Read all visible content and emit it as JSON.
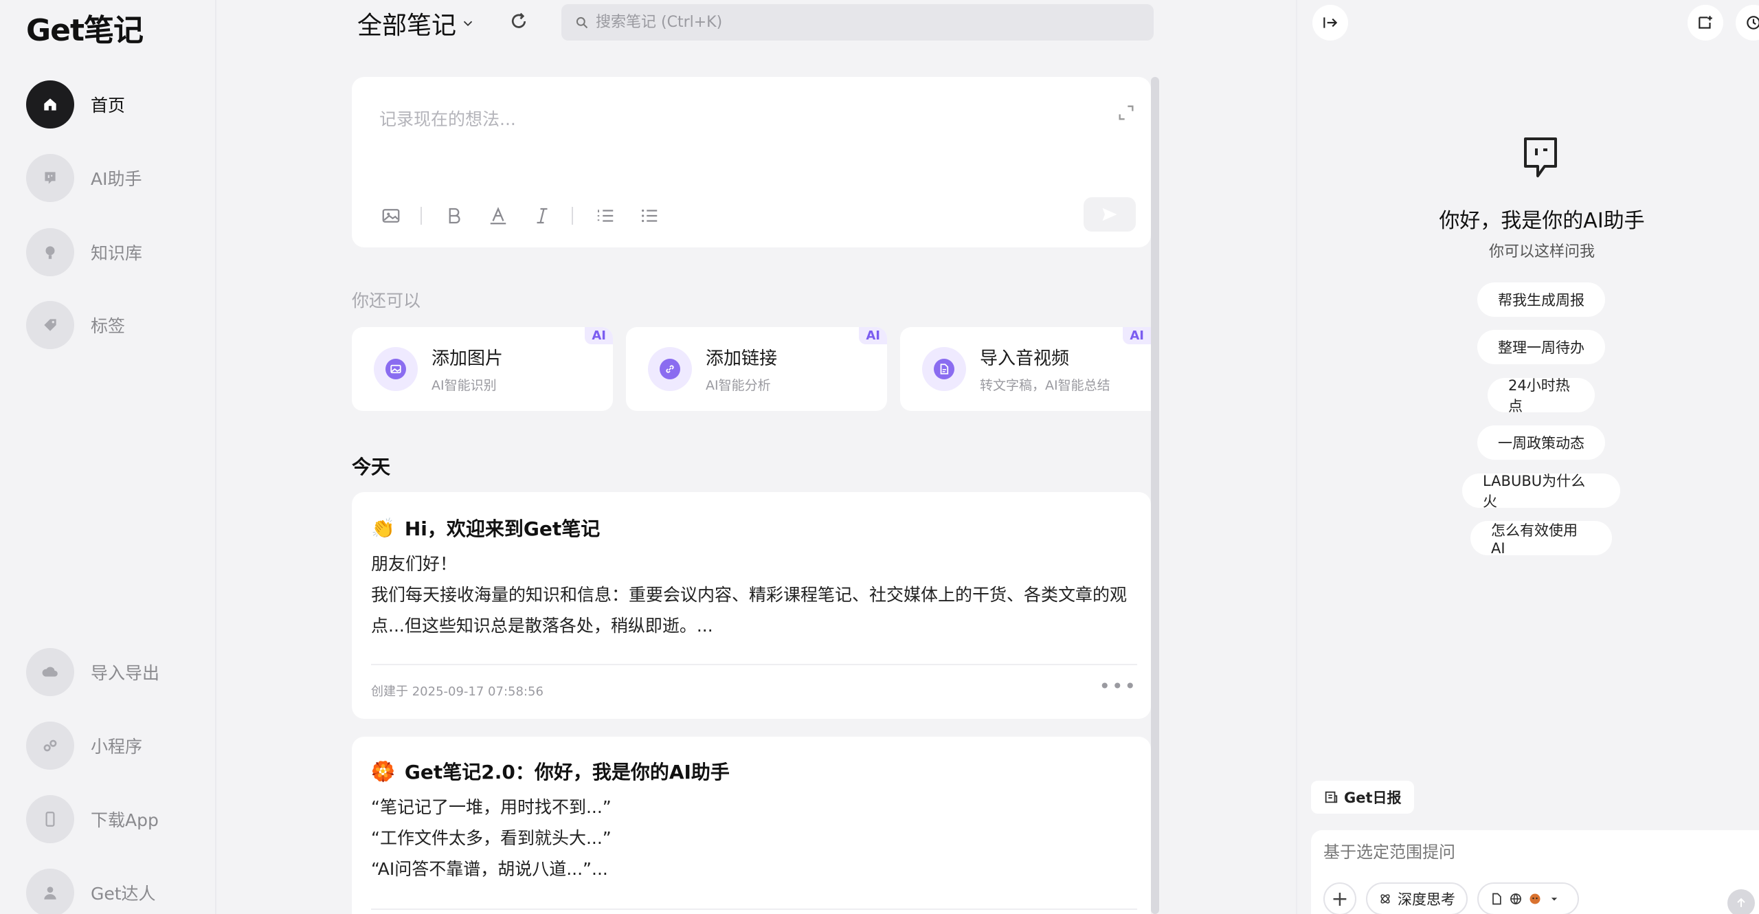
{
  "app": {
    "logo": "Get笔记"
  },
  "sidebar": {
    "items": [
      {
        "label": "首页",
        "icon": "home-icon"
      },
      {
        "label": "AI助手",
        "icon": "ai-assistant-icon"
      },
      {
        "label": "知识库",
        "icon": "knowledge-base-icon"
      },
      {
        "label": "标签",
        "icon": "tag-icon"
      }
    ],
    "bottom_items": [
      {
        "label": "导入导出",
        "icon": "cloud-icon"
      },
      {
        "label": "小程序",
        "icon": "mini-program-icon"
      },
      {
        "label": "下载App",
        "icon": "phone-icon"
      },
      {
        "label": "Get达人",
        "icon": "user-icon"
      }
    ]
  },
  "header": {
    "title": "全部笔记",
    "search_placeholder": "搜索笔记 (Ctrl+K)"
  },
  "editor": {
    "placeholder": "记录现在的想法..."
  },
  "suggestions": {
    "label": "你还可以",
    "cards": [
      {
        "title": "添加图片",
        "subtitle": "AI智能识别",
        "badge": "AI",
        "icon": "image-icon"
      },
      {
        "title": "添加链接",
        "subtitle": "AI智能分析",
        "badge": "AI",
        "icon": "link-icon"
      },
      {
        "title": "导入音视频",
        "subtitle": "转文字稿，AI智能总结",
        "badge": "AI",
        "icon": "document-icon"
      }
    ]
  },
  "notes": {
    "day_label": "今天",
    "items": [
      {
        "emoji": "👏",
        "title": "Hi，欢迎来到Get笔记",
        "lines": [
          "朋友们好！",
          "我们每天接收海量的知识和信息：重要会议内容、精彩课程笔记、社交媒体上的干货、各类文章的观",
          "点...但这些知识总是散落各处，稍纵即逝。..."
        ],
        "date": "创建于 2025-09-17 07:58:56",
        "more": "•••"
      },
      {
        "emoji": "🏵️",
        "title": "Get笔记2.0：你好，我是你的AI助手",
        "lines": [
          "“笔记记了一堆，用时找不到...”",
          "“工作文件太多，看到就头大...”",
          "“AI问答不靠谱，胡说八道...”..."
        ]
      }
    ]
  },
  "assistant": {
    "greeting": "你好，我是你的AI助手",
    "subtitle": "你可以这样问我",
    "chips": [
      "帮我生成周报",
      "整理一周待办",
      "24小时热点",
      "一周政策动态",
      "LABUBU为什么火",
      "怎么有效使用AI"
    ],
    "daily_tag": "Get日报",
    "input_placeholder": "基于选定范围提问",
    "deep_think": "深度思考"
  },
  "colors": {
    "accent": "#8a6cf0",
    "active_nav": "#1c1c1e"
  }
}
